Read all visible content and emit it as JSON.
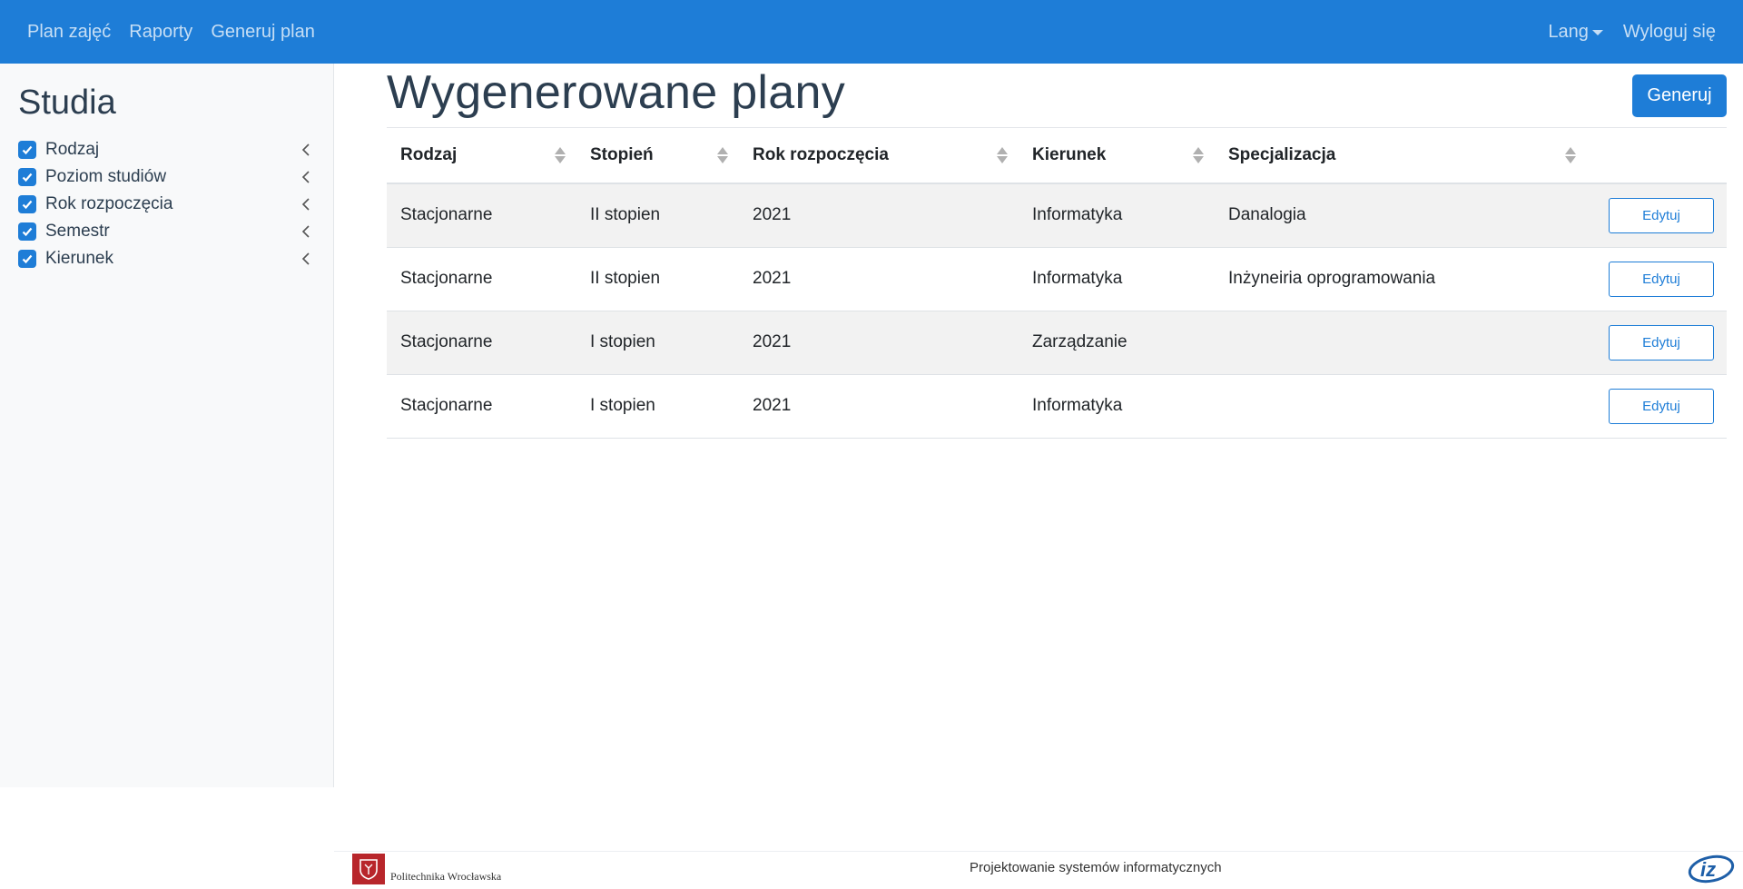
{
  "nav": {
    "links": [
      "Plan zajęć",
      "Raporty",
      "Generuj plan"
    ],
    "lang": "Lang",
    "logout": "Wyloguj się"
  },
  "sidebar": {
    "title": "Studia",
    "filters": [
      {
        "label": "Rodzaj",
        "checked": true
      },
      {
        "label": "Poziom studiów",
        "checked": true
      },
      {
        "label": "Rok rozpoczęcia",
        "checked": true
      },
      {
        "label": "Semestr",
        "checked": true
      },
      {
        "label": "Kierunek",
        "checked": true
      }
    ]
  },
  "main": {
    "title": "Wygenerowane plany",
    "generate_label": "Generuj",
    "columns": [
      "Rodzaj",
      "Stopień",
      "Rok rozpoczęcia",
      "Kierunek",
      "Specjalizacja"
    ],
    "rows": [
      [
        "Stacjonarne",
        "II stopien",
        "2021",
        "Informatyka",
        "Danalogia"
      ],
      [
        "Stacjonarne",
        "II stopien",
        "2021",
        "Informatyka",
        "Inżyneiria oprogramowania"
      ],
      [
        "Stacjonarne",
        "I stopien",
        "2021",
        "Zarządzanie",
        ""
      ],
      [
        "Stacjonarne",
        "I stopien",
        "2021",
        "Informatyka",
        ""
      ]
    ],
    "edit_label": "Edytuj"
  },
  "footer": {
    "university": "Politechnika Wrocławska",
    "text": "Projektowanie systemów informatycznych",
    "iz_logo": "iz"
  },
  "colors": {
    "primary": "#1e7dd7",
    "striped_row": "#f2f2f2",
    "sidebar_bg": "#f8f9fa"
  }
}
